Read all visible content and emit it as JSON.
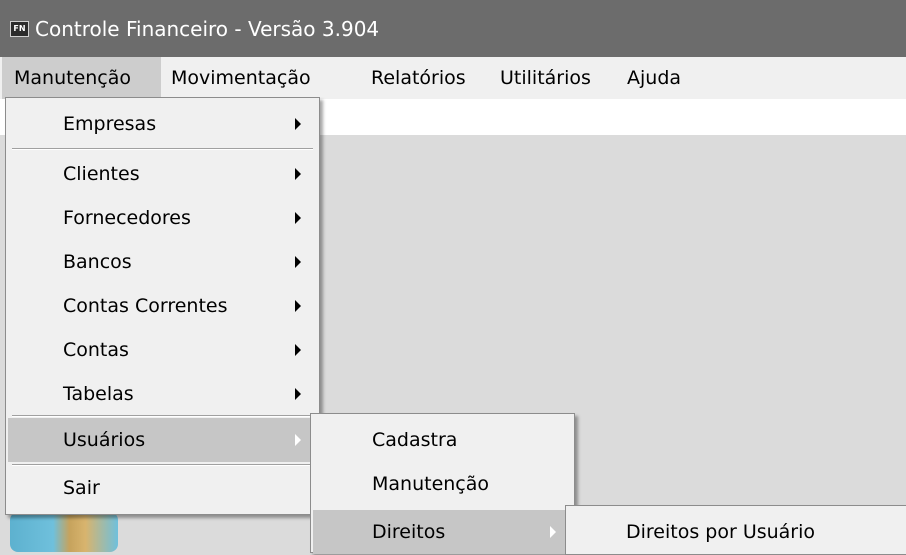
{
  "window": {
    "icon_text": "FN",
    "title": "Controle Financeiro - Versão 3.904"
  },
  "menubar": {
    "items": [
      "Manutenção",
      "Movimentação",
      "Relatórios",
      "Utilitários",
      "Ajuda"
    ],
    "active": "Manutenção"
  },
  "menu_manutencao": {
    "items": [
      {
        "label": "Empresas",
        "submenu": true
      },
      {
        "label": "Clientes",
        "submenu": true
      },
      {
        "label": "Fornecedores",
        "submenu": true
      },
      {
        "label": "Bancos",
        "submenu": true
      },
      {
        "label": "Contas Correntes",
        "submenu": true
      },
      {
        "label": "Contas",
        "submenu": true
      },
      {
        "label": "Tabelas",
        "submenu": true
      },
      {
        "label": "Usuários",
        "submenu": true,
        "highlighted": true
      },
      {
        "label": "Sair",
        "submenu": false
      }
    ]
  },
  "menu_usuarios": {
    "items": [
      {
        "label": "Cadastra",
        "submenu": false
      },
      {
        "label": "Manutenção",
        "submenu": false
      },
      {
        "label": "Direitos",
        "submenu": true,
        "highlighted": true
      }
    ]
  },
  "menu_direitos": {
    "items": [
      {
        "label": "Direitos por Usuário",
        "submenu": false
      }
    ]
  },
  "colors": {
    "titlebar": "#6c6c6c",
    "menu_bg": "#f0f0f0",
    "highlight": "#c6c6c6",
    "workspace": "#dbdbdb"
  }
}
